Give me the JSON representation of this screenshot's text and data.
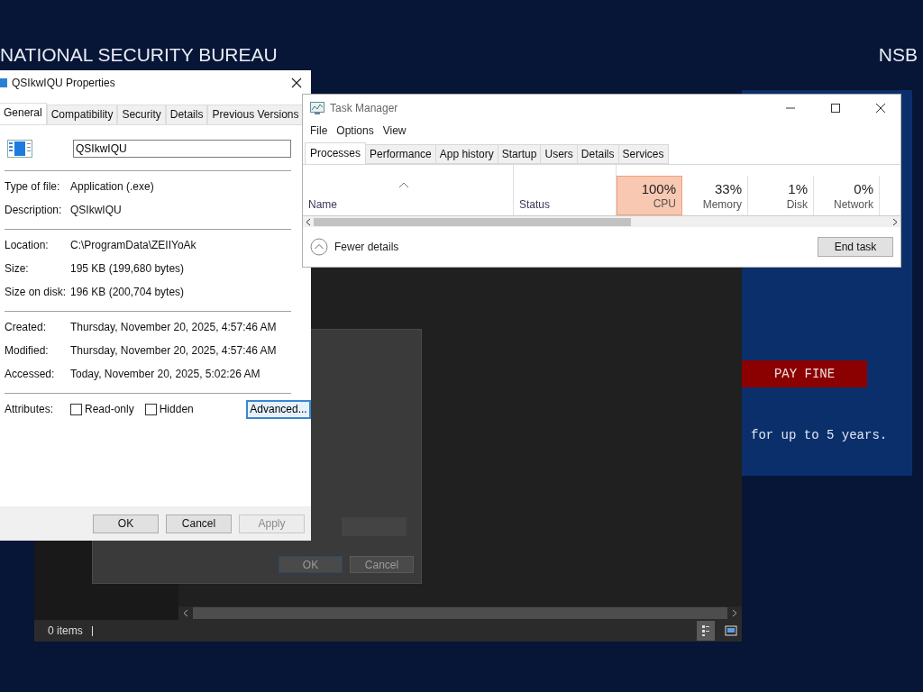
{
  "desktop": {
    "banner_title": "NATIONAL SECURITY BUREAU",
    "banner_badge": "NSB",
    "pay_button": "PAY FINE",
    "notice_text": "for up to 5 years."
  },
  "explorer": {
    "status": "0 items",
    "views": [
      {
        "kind": "details",
        "selected": true
      },
      {
        "kind": "tiles",
        "selected": false
      }
    ]
  },
  "advanced_attributes": {
    "buttons": [
      {
        "label": "OK"
      },
      {
        "label": "Cancel"
      }
    ]
  },
  "properties": {
    "title": "QSIkwIQU Properties",
    "tabs": [
      {
        "label": "General",
        "selected": true
      },
      {
        "label": "Compatibility",
        "selected": false
      },
      {
        "label": "Security",
        "selected": false
      },
      {
        "label": "Details",
        "selected": false
      },
      {
        "label": "Previous Versions",
        "selected": false
      }
    ],
    "file_name": "QSIkwIQU",
    "sections": [
      [
        {
          "label": "Type of file:",
          "value": "Application (.exe)"
        },
        {
          "label": "Description:",
          "value": "QSIkwIQU"
        }
      ],
      [
        {
          "label": "Location:",
          "value": "C:\\ProgramData\\ZEIIYoAk"
        },
        {
          "label": "Size:",
          "value": "195 KB (199,680 bytes)"
        },
        {
          "label": "Size on disk:",
          "value": "196 KB (200,704 bytes)"
        }
      ],
      [
        {
          "label": "Created:",
          "value": "Thursday, November 20, 2025, 4:57:46 AM"
        },
        {
          "label": "Modified:",
          "value": "Thursday, November 20, 2025, 4:57:46 AM"
        },
        {
          "label": "Accessed:",
          "value": "Today, November 20, 2025, 5:02:26 AM"
        }
      ]
    ],
    "attributes_label": "Attributes:",
    "attributes": [
      {
        "label": "Read-only",
        "checked": false
      },
      {
        "label": "Hidden",
        "checked": false
      }
    ],
    "advanced_button": "Advanced...",
    "buttons": [
      {
        "label": "OK",
        "disabled": false
      },
      {
        "label": "Cancel",
        "disabled": false
      },
      {
        "label": "Apply",
        "disabled": true
      }
    ]
  },
  "task_manager": {
    "title": "Task Manager",
    "menu": [
      "File",
      "Options",
      "View"
    ],
    "tabs": [
      {
        "label": "Processes",
        "selected": true
      },
      {
        "label": "Performance",
        "selected": false
      },
      {
        "label": "App history",
        "selected": false
      },
      {
        "label": "Startup",
        "selected": false
      },
      {
        "label": "Users",
        "selected": false
      },
      {
        "label": "Details",
        "selected": false
      },
      {
        "label": "Services",
        "selected": false
      }
    ],
    "columns": [
      {
        "label": "Name",
        "sorted": true,
        "highlighted": false
      },
      {
        "label": "Status",
        "sorted": false,
        "highlighted": false
      },
      {
        "label": "CPU",
        "usage": "100%",
        "sorted": false,
        "highlighted": true
      },
      {
        "label": "Memory",
        "usage": "33%",
        "sorted": false,
        "highlighted": false
      },
      {
        "label": "Disk",
        "usage": "1%",
        "sorted": false,
        "highlighted": false
      },
      {
        "label": "Network",
        "usage": "0%",
        "sorted": false,
        "highlighted": false
      }
    ],
    "fewer_details": "Fewer details",
    "end_task_button": "End task"
  }
}
